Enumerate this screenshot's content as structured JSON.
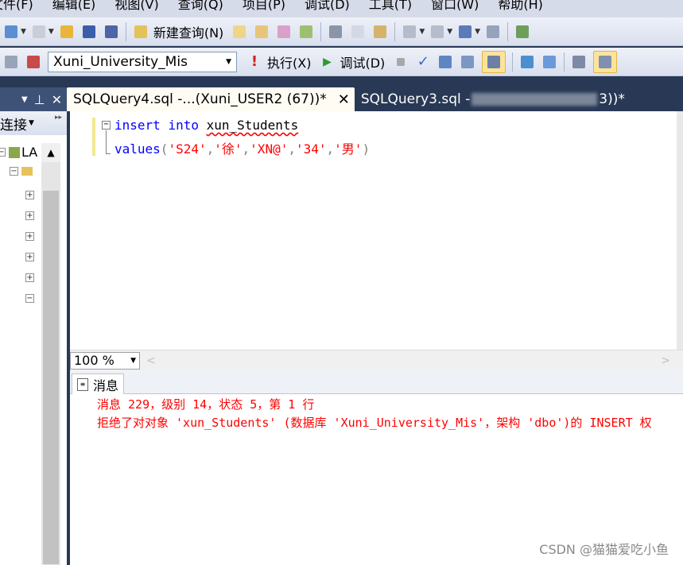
{
  "menu": [
    "文件(F)",
    "编辑(E)",
    "视图(V)",
    "查询(Q)",
    "项目(P)",
    "调试(D)",
    "工具(T)",
    "窗口(W)",
    "帮助(H)"
  ],
  "toolbar": {
    "new_query_label": "新建查询(N)",
    "database_selected": "Xuni_University_Mis",
    "execute_label": "执行(X)",
    "debug_label": "调试(D)"
  },
  "object_explorer": {
    "connect_label": "连接",
    "server_label": "LA"
  },
  "tabs": [
    {
      "label": "SQLQuery4.sql -...(Xuni_USER2 (67))*",
      "active": true
    },
    {
      "label_prefix": "SQLQuery3.sql -",
      "label_suffix": "3))*",
      "active": false
    }
  ],
  "editor": {
    "line1": {
      "kw1": "insert",
      "kw2": "into",
      "table": "xun_Students"
    },
    "line2": {
      "kw": "values",
      "open": "(",
      "v1": "'S24'",
      "c": ",",
      "v2": "'徐'",
      "v3": "'XN@'",
      "v4": "'34'",
      "v5": "'男'",
      "close": ")"
    }
  },
  "zoom": "100 %",
  "results": {
    "tab_label": "消息",
    "line1": "消息 229，级别 14，状态 5，第 1 行",
    "line2": "拒绝了对对象 'xun_Students' (数据库 'Xuni_University_Mis'，架构 'dbo')的 INSERT 权"
  },
  "watermark": "CSDN @猫猫爱吃小鱼",
  "colors": {
    "keyword": "#0000ff",
    "string": "#ff0000",
    "error_text": "#ff0000",
    "chrome_dark": "#293955"
  }
}
